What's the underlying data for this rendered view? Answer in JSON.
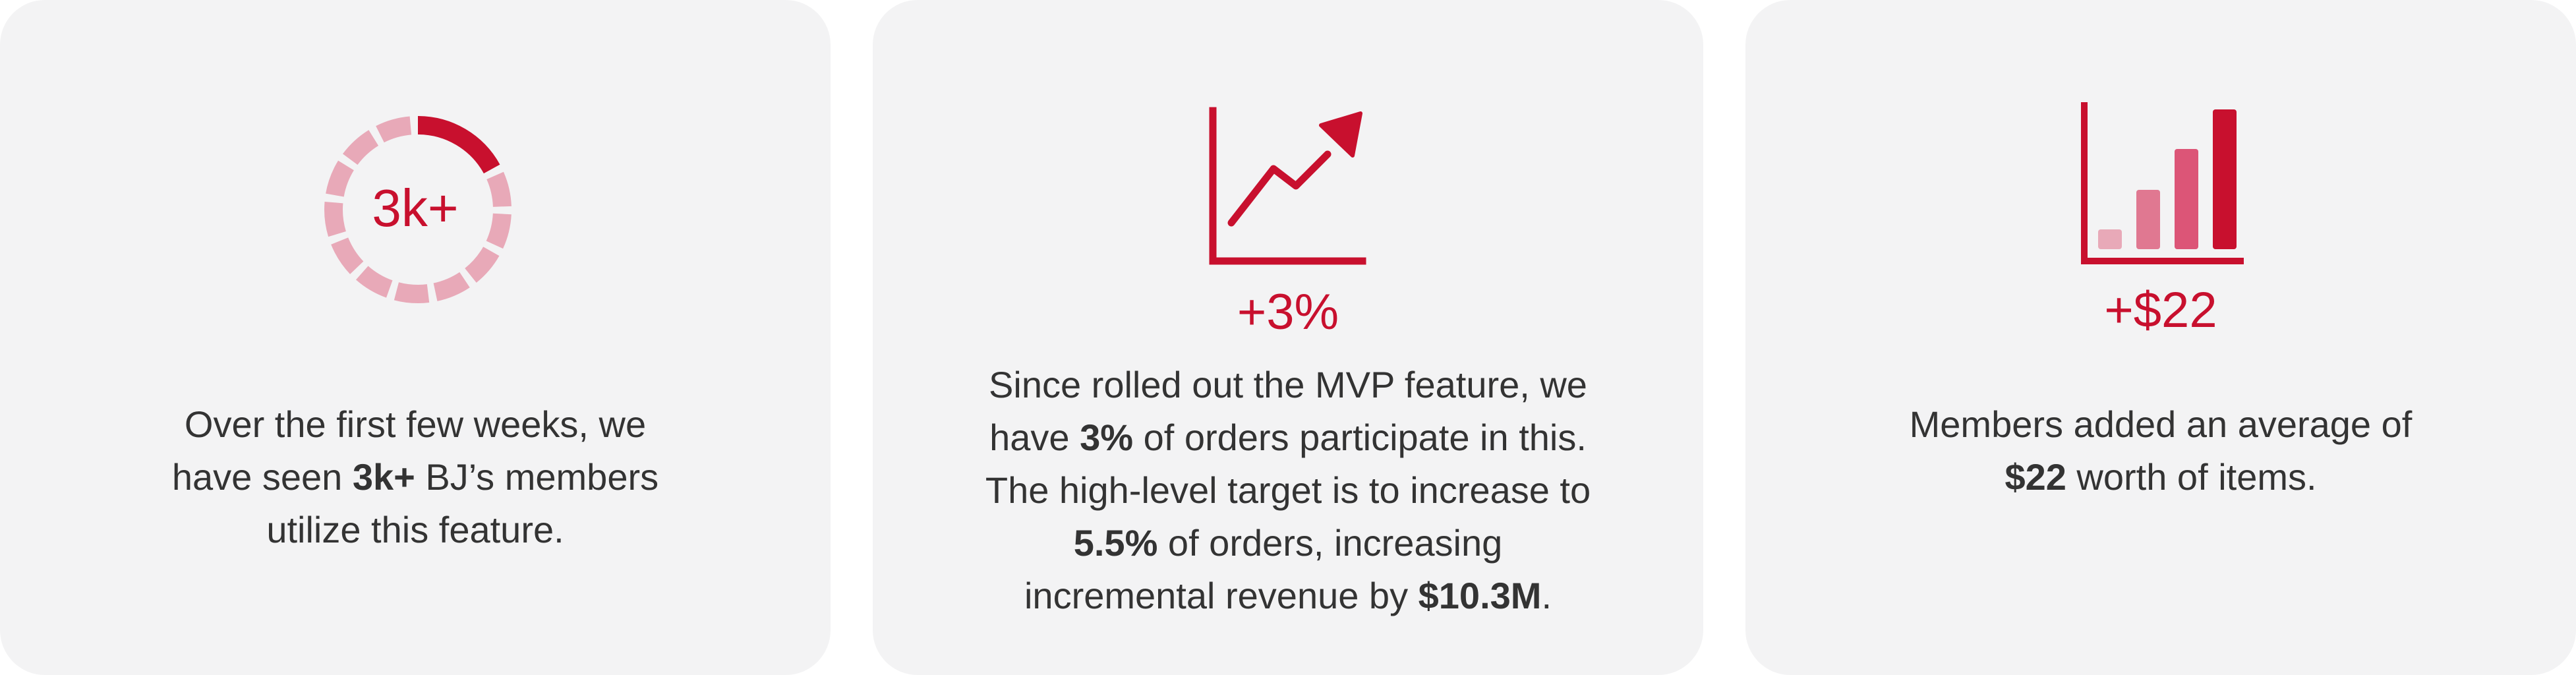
{
  "colors": {
    "card_background": "#f3f3f4",
    "accent": "#c8102e",
    "accent_light": "#e8a9b8",
    "accent_mid": "#e07891",
    "accent_mid2": "#dc5577",
    "text": "#333333"
  },
  "cards": [
    {
      "icon": "progress-ring-icon",
      "stat": "3k+",
      "progress_fraction": 0.17,
      "lines": [
        [
          "Over the first few weeks, we"
        ],
        [
          "have seen ",
          "3k+",
          " BJ’s members"
        ],
        [
          "utilize this feature."
        ]
      ]
    },
    {
      "icon": "trend-up-chart-icon",
      "stat": "+3%",
      "lines": [
        [
          "Since rolled out the MVP feature, we"
        ],
        [
          "have ",
          "3%",
          " of orders participate in this."
        ],
        [
          "The high-level target is to increase to"
        ],
        [
          "5.5%",
          " of orders, increasing"
        ],
        [
          "incremental revenue by ",
          "$10.3M",
          "."
        ]
      ]
    },
    {
      "icon": "bar-chart-icon",
      "stat": "+$22",
      "lines": [
        [
          "Members added an average of"
        ],
        [
          "$22",
          " worth of items."
        ]
      ]
    }
  ]
}
